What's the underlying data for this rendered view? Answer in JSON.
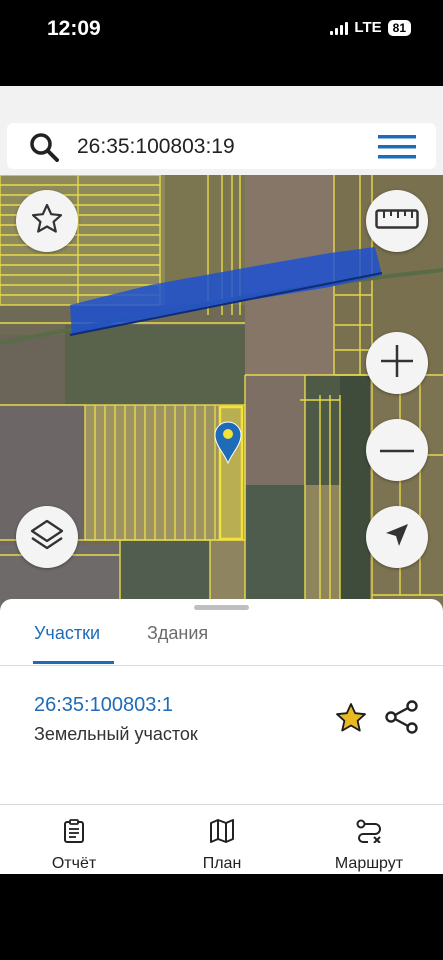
{
  "status_bar": {
    "time": "12:09",
    "network": "LTE",
    "battery": "81"
  },
  "search": {
    "query": "26:35:100803:19"
  },
  "sheet": {
    "tabs": [
      {
        "label": "Участки",
        "active": true
      },
      {
        "label": "Здания",
        "active": false
      }
    ],
    "plot": {
      "number": "26:35:100803:1",
      "type": "Земельный участок"
    },
    "pager": {
      "count": 3,
      "active_index": 1
    }
  },
  "bottom_nav": [
    {
      "label": "Отчёт",
      "icon": "report-icon"
    },
    {
      "label": "План",
      "icon": "map-plan-icon"
    },
    {
      "label": "Маршрут",
      "icon": "route-icon"
    }
  ],
  "colors": {
    "accent": "#1e6bb8",
    "parcel_outline": "#f2e23a",
    "highlight_strip": "#1a4fd6",
    "marker": "#1e6bb8",
    "favorite_star": "#e8b923"
  },
  "icons": {
    "search": "search-icon",
    "menu": "hamburger-menu-icon",
    "favorite": "star-outline-icon",
    "ruler": "ruler-icon",
    "zoom_in": "plus-icon",
    "zoom_out": "minus-icon",
    "layers": "layers-icon",
    "locate": "navigation-arrow-icon",
    "plot_favorite": "star-filled-icon",
    "share": "share-icon"
  }
}
